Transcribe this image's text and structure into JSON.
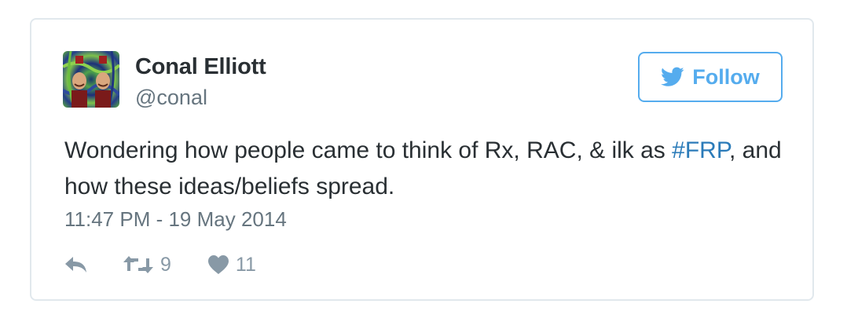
{
  "tweet": {
    "author_name": "Conal Elliott",
    "author_handle": "@conal",
    "text_before": "Wondering how people came to think of Rx, RAC, & ilk as ",
    "hashtag": "#FRP",
    "text_after": ", and how these ideas/beliefs spread.",
    "timestamp": "11:47 PM - 19 May 2014",
    "retweet_count": "9",
    "like_count": "11"
  },
  "follow_button": {
    "label": "Follow",
    "icon": "twitter-bird-icon"
  },
  "icons": {
    "reply": "reply-icon",
    "retweet": "retweet-icon",
    "like": "heart-icon"
  },
  "colors": {
    "accent": "#55acee",
    "link": "#2b7bb9",
    "text": "#292f33",
    "muted": "#66757f",
    "action": "#8899a6",
    "border": "#e1e8ed"
  }
}
